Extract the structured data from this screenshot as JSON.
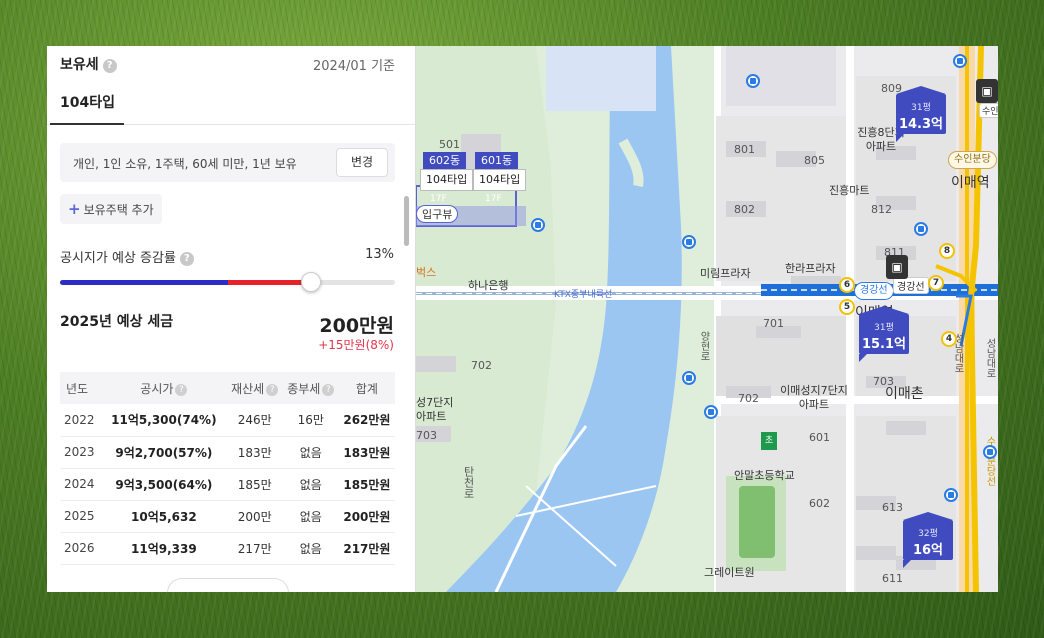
{
  "panel": {
    "title": "보유세",
    "help": "?",
    "as_of": "2024/01 기준",
    "tab": "104타입",
    "condition": "개인, 1인 소유, 1주택, 60세 미만, 1년 보유",
    "change_button": "변경",
    "add_button": "보유주택 추가",
    "rate_label": "공시지가 예상 증감률",
    "rate_value": "13%",
    "slider_level_percent": 75,
    "slider_red_start_percent": 50,
    "tax_title": "2025년 예상 세금",
    "tax_amount": "200만원",
    "tax_delta": "+15만원(8%)",
    "table": {
      "headers": [
        "년도",
        "공시가",
        "재산세",
        "종부세",
        "합계"
      ],
      "rows": [
        [
          "2022",
          "11억5,300(74%)",
          "246만",
          "16만",
          "262만원"
        ],
        [
          "2023",
          "9억2,700(57%)",
          "183만",
          "없음",
          "183만원"
        ],
        [
          "2024",
          "9억3,500(64%)",
          "185만",
          "없음",
          "185만원"
        ],
        [
          "2025",
          "10억5,632",
          "200만",
          "없음",
          "200만원"
        ],
        [
          "2026",
          "11억9,339",
          "217만",
          "없음",
          "217만원"
        ]
      ]
    }
  },
  "map": {
    "dongs": [
      "602동",
      "601동"
    ],
    "type_tags": [
      "104타입",
      "104타입"
    ],
    "floors": [
      "17F",
      "17F"
    ],
    "partial_label": "입구뷰",
    "pins": [
      {
        "py": "31평",
        "price": "14.3억"
      },
      {
        "py": "31평",
        "price": "15.1억"
      },
      {
        "py": "32평",
        "price": "16억"
      }
    ],
    "labels": {
      "b501": "501",
      "b801": "801",
      "b805": "805",
      "b809": "809",
      "b802": "802",
      "b812": "812",
      "b811": "811",
      "b701": "701",
      "b702": "702",
      "b703": "703",
      "b601": "601",
      "b602": "602",
      "b613": "613",
      "b611": "611",
      "b702b": "702",
      "b703b": "703",
      "apt8": "진흥8단지\n아파트",
      "jinheung_mart": "진흥마트",
      "mirim": "미림프라자",
      "hanra": "한라프라자",
      "hana": "하나은행",
      "ktx": "KTX중부내륙선",
      "imae_station_top": "이매역",
      "imae_station_mid": "이매역",
      "imae_apt7": "이매성지7단지\n아파트",
      "imae_chon": "이매촌",
      "apt7_left": "성7단지\n아파트",
      "anmal_school": "안말초등학교",
      "gyeonggang": "경강선",
      "gyeonggang2": "경강선",
      "suin_bundang": "수인분당",
      "suin": "수인",
      "bucks": "벅스",
      "tancheon": "탄천로",
      "anyang_road": "양현로",
      "seongnam_road": "성남대로",
      "bottom_school": "그레이트원",
      "vert_right1": "수인분당선",
      "vert_right2": "성남대로"
    },
    "station_numbers": [
      "8",
      "6",
      "7",
      "5",
      "4"
    ],
    "school_flag": "초"
  }
}
